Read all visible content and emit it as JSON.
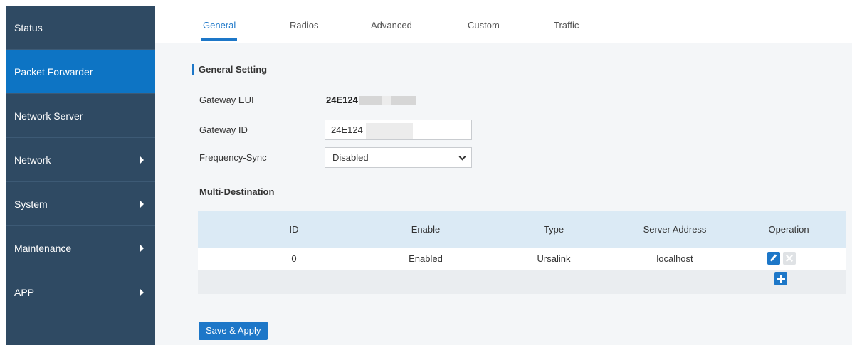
{
  "sidebar": {
    "items": [
      {
        "label": "Status",
        "has_submenu": false,
        "active": false
      },
      {
        "label": "Packet Forwarder",
        "has_submenu": false,
        "active": true
      },
      {
        "label": "Network Server",
        "has_submenu": false,
        "active": false
      },
      {
        "label": "Network",
        "has_submenu": true,
        "active": false
      },
      {
        "label": "System",
        "has_submenu": true,
        "active": false
      },
      {
        "label": "Maintenance",
        "has_submenu": true,
        "active": false
      },
      {
        "label": "APP",
        "has_submenu": true,
        "active": false
      }
    ]
  },
  "tabs": [
    {
      "label": "General",
      "active": true
    },
    {
      "label": "Radios",
      "active": false
    },
    {
      "label": "Advanced",
      "active": false
    },
    {
      "label": "Custom",
      "active": false
    },
    {
      "label": "Traffic",
      "active": false
    }
  ],
  "general": {
    "section_title": "General Setting",
    "gateway_eui_label": "Gateway EUI",
    "gateway_eui_value": "24E124",
    "gateway_id_label": "Gateway ID",
    "gateway_id_value": "24E124",
    "frequency_sync_label": "Frequency-Sync",
    "frequency_sync_value": "Disabled"
  },
  "multi_destination": {
    "title": "Multi-Destination",
    "columns": {
      "id": "ID",
      "enable": "Enable",
      "type": "Type",
      "server_address": "Server Address",
      "operation": "Operation"
    },
    "rows": [
      {
        "id": "0",
        "enable": "Enabled",
        "type": "Ursalink",
        "server_address": "localhost"
      }
    ]
  },
  "actions": {
    "save_label": "Save & Apply"
  },
  "colors": {
    "sidebar_bg": "#2f4a63",
    "sidebar_active": "#0d74c4",
    "accent": "#1d77c8",
    "table_header_bg": "#dbeaf5"
  }
}
